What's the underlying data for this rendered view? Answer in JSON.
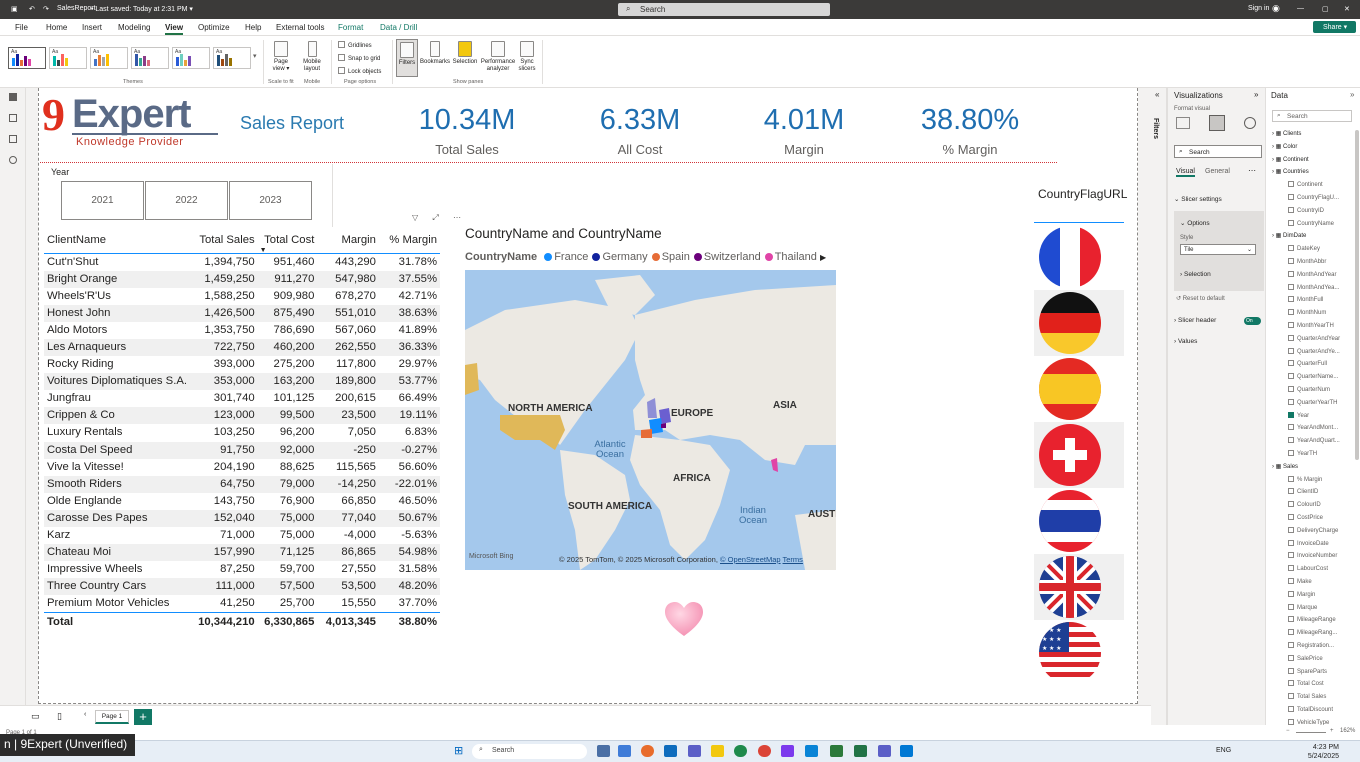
{
  "titlebar": {
    "file_name": "SalesReport",
    "saved": " • Last saved: Today at 2:31 PM ▾",
    "search_placeholder": "Search",
    "signin": "Sign in"
  },
  "menu": [
    "File",
    "Home",
    "Insert",
    "Modeling",
    "View",
    "Optimize",
    "Help",
    "External tools",
    "Format",
    "Data / Drill"
  ],
  "share_label": "Share ▾",
  "ribbon": {
    "themes_label": "Themes",
    "page_view": "Page view ▾",
    "mobile_layout": "Mobile layout",
    "scale_label": "Scale to fit",
    "mobile_label": "Mobile",
    "gridlines": "Gridlines",
    "snap": "Snap to grid",
    "lock": "Lock objects",
    "page_options_label": "Page options",
    "filters": "Filters",
    "bookmarks": "Bookmarks",
    "selection": "Selection",
    "performance": "Performance analyzer",
    "sync": "Sync slicers",
    "show_panes_label": "Show panes"
  },
  "report": {
    "logo_nine": "9",
    "logo_expert": "Expert",
    "logo_tag": "Knowledge Provider",
    "title": "Sales Report",
    "kpis": [
      {
        "value": "10.34M",
        "label": "Total Sales"
      },
      {
        "value": "6.33M",
        "label": "All Cost"
      },
      {
        "value": "4.01M",
        "label": "Margin"
      },
      {
        "value": "38.80%",
        "label": "% Margin"
      }
    ],
    "slicer": {
      "title": "Year",
      "tiles": [
        "2021",
        "2022",
        "2023"
      ]
    },
    "visual_icons": "▽ ⤢ ⋯"
  },
  "table": {
    "headers": [
      "ClientName",
      "Total Sales",
      "Total Cost",
      "Margin",
      "% Margin"
    ],
    "sort_indicator": "▼",
    "rows": [
      [
        "Cut'n'Shut",
        "1,394,750",
        "951,460",
        "443,290",
        "31.78%"
      ],
      [
        "Bright Orange",
        "1,459,250",
        "911,270",
        "547,980",
        "37.55%"
      ],
      [
        "Wheels'R'Us",
        "1,588,250",
        "909,980",
        "678,270",
        "42.71%"
      ],
      [
        "Honest John",
        "1,426,500",
        "875,490",
        "551,010",
        "38.63%"
      ],
      [
        "Aldo Motors",
        "1,353,750",
        "786,690",
        "567,060",
        "41.89%"
      ],
      [
        "Les Arnaqueurs",
        "722,750",
        "460,200",
        "262,550",
        "36.33%"
      ],
      [
        "Rocky Riding",
        "393,000",
        "275,200",
        "117,800",
        "29.97%"
      ],
      [
        "Voitures Diplomatiques S.A.",
        "353,000",
        "163,200",
        "189,800",
        "53.77%"
      ],
      [
        "Jungfrau",
        "301,740",
        "101,125",
        "200,615",
        "66.49%"
      ],
      [
        "Crippen & Co",
        "123,000",
        "99,500",
        "23,500",
        "19.11%"
      ],
      [
        "Luxury Rentals",
        "103,250",
        "96,200",
        "7,050",
        "6.83%"
      ],
      [
        "Costa Del Speed",
        "91,750",
        "92,000",
        "-250",
        "-0.27%"
      ],
      [
        "Vive la Vitesse!",
        "204,190",
        "88,625",
        "115,565",
        "56.60%"
      ],
      [
        "Smooth Riders",
        "64,750",
        "79,000",
        "-14,250",
        "-22.01%"
      ],
      [
        "Olde Englande",
        "143,750",
        "76,900",
        "66,850",
        "46.50%"
      ],
      [
        "Carosse Des Papes",
        "152,040",
        "75,000",
        "77,040",
        "50.67%"
      ],
      [
        "Karz",
        "71,000",
        "75,000",
        "-4,000",
        "-5.63%"
      ],
      [
        "Chateau Moi",
        "157,990",
        "71,125",
        "86,865",
        "54.98%"
      ],
      [
        "Impressive Wheels",
        "87,250",
        "59,700",
        "27,550",
        "31.58%"
      ],
      [
        "Three Country Cars",
        "111,000",
        "57,500",
        "53,500",
        "48.20%"
      ],
      [
        "Premium Motor Vehicles",
        "41,250",
        "25,700",
        "15,550",
        "37.70%"
      ]
    ],
    "total": [
      "Total",
      "10,344,210",
      "6,330,865",
      "4,013,345",
      "38.80%"
    ]
  },
  "map": {
    "title": "CountryName and CountryName",
    "legend_title": "CountryName",
    "legend": [
      {
        "name": "France",
        "color": "#118dff"
      },
      {
        "name": "Germany",
        "color": "#12239e"
      },
      {
        "name": "Spain",
        "color": "#e66c37"
      },
      {
        "name": "Switzerland",
        "color": "#6b007b"
      },
      {
        "name": "Thailand",
        "color": "#e044a7"
      }
    ],
    "legend_more": "▶",
    "labels": {
      "north_america": "NORTH AMERICA",
      "europe": "EUROPE",
      "asia": "ASIA",
      "africa": "AFRICA",
      "south_america": "SOUTH AMERICA",
      "australia": "AUSTI",
      "atlantic": "Atlantic Ocean",
      "indian": "Indian Ocean"
    },
    "attribution": "© 2025 TomTom, © 2025 Microsoft Corporation,",
    "osm": "© OpenStreetMap",
    "terms": "Terms",
    "bing": "Microsoft Bing"
  },
  "flags": {
    "header": "CountryFlagURL",
    "countries": [
      "France",
      "Germany",
      "Spain",
      "Switzerland",
      "Thailand",
      "United Kingdom",
      "United States"
    ]
  },
  "viz_pane": {
    "title": "Visualizations",
    "format_visual": "Format visual",
    "search_placeholder": "Search",
    "tab_visual": "Visual",
    "tab_general": "General",
    "slicer_settings": "Slicer settings",
    "options": "Options",
    "style_label": "Style",
    "style_value": "Tile",
    "selection": "Selection",
    "reset": "Reset to default",
    "slicer_header": "Slicer header",
    "toggle": "On",
    "values": "Values",
    "filters_tab": "Filters"
  },
  "data_pane": {
    "title": "Data",
    "search_placeholder": "Search",
    "items": [
      {
        "t": "table",
        "label": "Clients"
      },
      {
        "t": "table",
        "label": "Color"
      },
      {
        "t": "table",
        "label": "Continent"
      },
      {
        "t": "table",
        "label": "Countries"
      },
      {
        "t": "field",
        "label": "Continent"
      },
      {
        "t": "field",
        "label": "CountryFlagU..."
      },
      {
        "t": "field",
        "label": "CountryID"
      },
      {
        "t": "field",
        "label": "CountryName"
      },
      {
        "t": "table",
        "label": "DimDate"
      },
      {
        "t": "field",
        "label": "DateKey"
      },
      {
        "t": "field",
        "label": "MonthAbbr"
      },
      {
        "t": "field",
        "label": "MonthAndYear"
      },
      {
        "t": "field",
        "label": "MonthAndYea..."
      },
      {
        "t": "field",
        "label": "MonthFull"
      },
      {
        "t": "field",
        "label": "MonthNum"
      },
      {
        "t": "field",
        "label": "MonthYearTH"
      },
      {
        "t": "field",
        "label": "QuarterAndYear"
      },
      {
        "t": "field",
        "label": "QuarterAndYe..."
      },
      {
        "t": "field",
        "label": "QuarterFull"
      },
      {
        "t": "field",
        "label": "QuarterName..."
      },
      {
        "t": "field",
        "label": "QuarterNum"
      },
      {
        "t": "field",
        "label": "QuarterYearTH"
      },
      {
        "t": "field",
        "label": "Year",
        "checked": true
      },
      {
        "t": "field",
        "label": "YearAndMont..."
      },
      {
        "t": "field",
        "label": "YearAndQuart..."
      },
      {
        "t": "field",
        "label": "YearTH"
      },
      {
        "t": "table",
        "label": "Sales"
      },
      {
        "t": "field",
        "label": "% Margin"
      },
      {
        "t": "field",
        "label": "ClientID"
      },
      {
        "t": "field",
        "label": "ColourID"
      },
      {
        "t": "field",
        "label": "CostPrice"
      },
      {
        "t": "field",
        "label": "DeliveryCharge"
      },
      {
        "t": "field",
        "label": "InvoiceDate"
      },
      {
        "t": "field",
        "label": "InvoiceNumber"
      },
      {
        "t": "field",
        "label": "LabourCost"
      },
      {
        "t": "field",
        "label": "Make"
      },
      {
        "t": "field",
        "label": "Margin"
      },
      {
        "t": "field",
        "label": "Marque"
      },
      {
        "t": "field",
        "label": "MileageRange"
      },
      {
        "t": "field",
        "label": "MileageRang..."
      },
      {
        "t": "field",
        "label": "Registration..."
      },
      {
        "t": "field",
        "label": "SalePrice"
      },
      {
        "t": "field",
        "label": "SpareParts"
      },
      {
        "t": "field",
        "label": "Total Cost"
      },
      {
        "t": "field",
        "label": "Total Sales"
      },
      {
        "t": "field",
        "label": "TotalDiscount"
      },
      {
        "t": "field",
        "label": "VehicleType"
      }
    ]
  },
  "status": {
    "page_tab": "Page 1",
    "add": "+",
    "page_of": "Page 1 of 1",
    "zoom": "162%"
  },
  "tooltip": "n | 9Expert (Unverified)",
  "taskbar": {
    "search": "Search",
    "lang": "ENG",
    "time": "4:23 PM",
    "date": "5/24/2025"
  }
}
